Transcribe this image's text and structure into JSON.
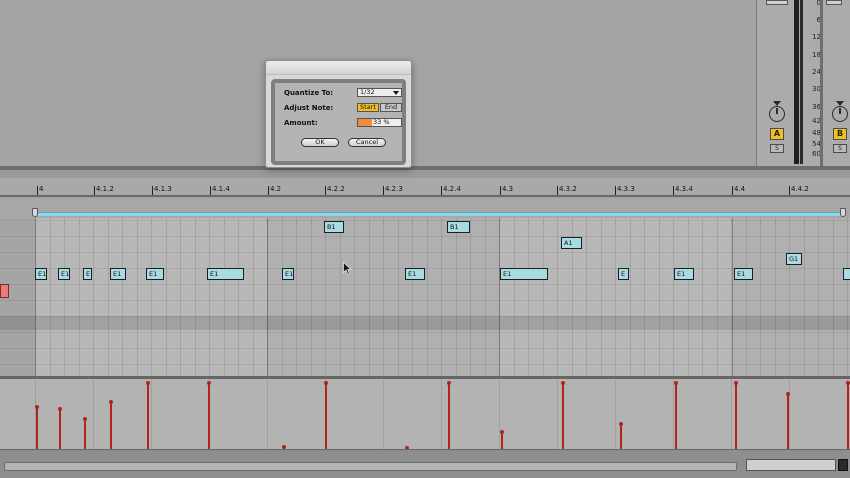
{
  "dialog": {
    "quantize_label": "Quantize To:",
    "quantize_value": "1/32",
    "adjust_label": "Adjust Note:",
    "adjust_start": "Start",
    "adjust_end": "End",
    "amount_label": "Amount:",
    "amount_value": "33 %",
    "amount_fraction": 0.33,
    "ok_label": "OK",
    "cancel_label": "Cancel"
  },
  "ruler": {
    "labels": [
      "4",
      "4.1.2",
      "4.1.3",
      "4.1.4",
      "4.2",
      "4.2.2",
      "4.2.3",
      "4.2.4",
      "4.3",
      "4.3.2",
      "4.3.3",
      "4.3.4",
      "4.4",
      "4.4.2"
    ]
  },
  "mixer": {
    "db_scale": [
      "0",
      "6",
      "12",
      "18",
      "24",
      "30",
      "36",
      "42",
      "48",
      "54",
      "60"
    ],
    "track_a_label": "A",
    "track_b_label": "B",
    "solo_label": "S"
  },
  "notes": [
    {
      "label": "B1"
    },
    {
      "label": "B1"
    },
    {
      "label": "A1"
    },
    {
      "label": "G1"
    },
    {
      "label": "E1"
    },
    {
      "label": "E1"
    },
    {
      "label": "E"
    },
    {
      "label": "E1"
    },
    {
      "label": "E1"
    },
    {
      "label": "E1"
    },
    {
      "label": "E1"
    },
    {
      "label": "E1"
    },
    {
      "label": "E1"
    },
    {
      "label": "E"
    },
    {
      "label": "E1"
    },
    {
      "label": "E1"
    }
  ],
  "colors": {
    "note_fill": "#a9dbe3",
    "velocity": "#b0241c",
    "track_button": "#f0c020",
    "amount_fill": "#f08a3c",
    "loop_bar": "#8ed6e8"
  },
  "icons": {
    "cursor": "arrow-pointer-icon",
    "pan_knob": "knob-icon",
    "dropdown": "chevron-down-icon"
  }
}
